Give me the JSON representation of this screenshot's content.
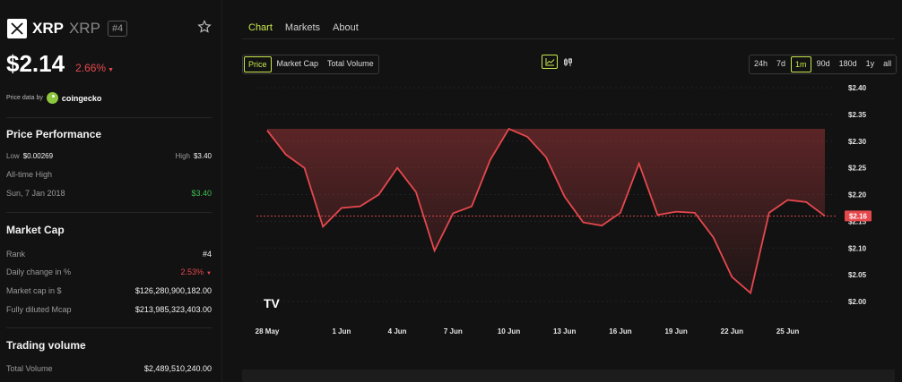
{
  "coin": {
    "name": "XRP",
    "symbol": "XRP",
    "rank_badge": "#4",
    "price": "$2.14",
    "change": "2.66%"
  },
  "source": {
    "prefix": "Price data by",
    "name": "coingecko"
  },
  "price_performance": {
    "title": "Price Performance",
    "low_label": "Low",
    "low_value": "$0.00269",
    "high_label": "High",
    "high_value": "$3.40",
    "ath_label": "All-time High",
    "ath_date": "Sun, 7 Jan 2018",
    "ath_value": "$3.40"
  },
  "market_cap": {
    "title": "Market Cap",
    "rows": [
      {
        "label": "Rank",
        "value": "#4"
      },
      {
        "label": "Daily change in %",
        "value": "2.53%"
      },
      {
        "label": "Market cap in $",
        "value": "$126,280,900,182.00"
      },
      {
        "label": "Fully diluted Mcap",
        "value": "$213,985,323,403.00"
      }
    ]
  },
  "trading_volume": {
    "title": "Trading volume",
    "label": "Total Volume",
    "value": "$2,489,510,240.00"
  },
  "tabs": [
    "Chart",
    "Markets",
    "About"
  ],
  "metric_buttons": [
    "Price",
    "Market Cap",
    "Total Volume"
  ],
  "range_buttons": [
    "24h",
    "7d",
    "1m",
    "90d",
    "180d",
    "1y",
    "all"
  ],
  "colors": {
    "accent": "#c6e84e",
    "down": "#e5484d",
    "up": "#3fbf4f",
    "line": "#e5484d"
  },
  "chart_data": {
    "type": "area",
    "x": [
      "28 May",
      "29 May",
      "30 May",
      "31 May",
      "1 Jun",
      "2 Jun",
      "3 Jun",
      "4 Jun",
      "5 Jun",
      "6 Jun",
      "7 Jun",
      "8 Jun",
      "9 Jun",
      "10 Jun",
      "11 Jun",
      "12 Jun",
      "13 Jun",
      "14 Jun",
      "15 Jun",
      "16 Jun",
      "17 Jun",
      "18 Jun",
      "19 Jun",
      "20 Jun",
      "21 Jun",
      "22 Jun",
      "23 Jun",
      "24 Jun",
      "25 Jun",
      "26 Jun",
      "27 Jun"
    ],
    "series": [
      {
        "values": [
          2.32,
          2.275,
          2.25,
          2.14,
          2.175,
          2.178,
          2.2,
          2.25,
          2.205,
          2.095,
          2.165,
          2.178,
          2.265,
          2.323,
          2.308,
          2.27,
          2.196,
          2.148,
          2.142,
          2.166,
          2.258,
          2.162,
          2.168,
          2.166,
          2.12,
          2.046,
          2.016,
          2.166,
          2.19,
          2.186,
          2.16
        ]
      }
    ],
    "x_ticks": [
      "28 May",
      "1 Jun",
      "4 Jun",
      "7 Jun",
      "10 Jun",
      "13 Jun",
      "16 Jun",
      "19 Jun",
      "22 Jun",
      "25 Jun"
    ],
    "y_ticks": [
      "$2.40",
      "$2.35",
      "$2.30",
      "$2.25",
      "$2.20",
      "$2.15",
      "$2.10",
      "$2.05",
      "$2.00"
    ],
    "ylim": [
      1.975,
      2.4
    ],
    "current_label": "$2.16",
    "current_value": 2.16,
    "grid": true,
    "watermark": "TV"
  }
}
